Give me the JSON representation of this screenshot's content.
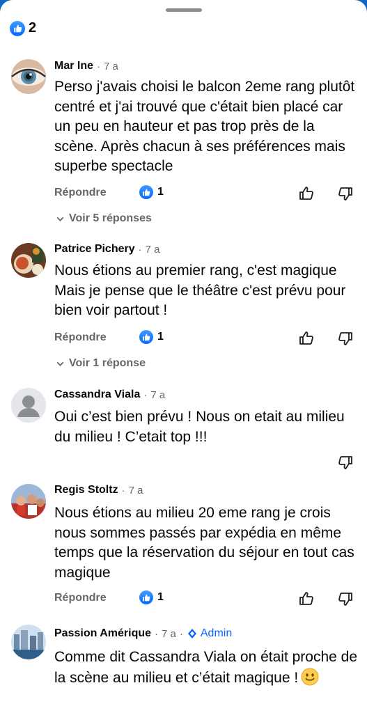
{
  "summary": {
    "like_count": "2"
  },
  "colors": {
    "brand_blue": "#0866ff",
    "muted_text": "#65676b",
    "background_frame": "#1565c0"
  },
  "comments": [
    {
      "author": "Mar Ine",
      "dot": "·",
      "time": "7 a",
      "text": "Perso j'avais choisi le balcon 2eme rang plutôt centré et j'ai trouvé que c'était bien placé car un peu en hauteur et pas trop près de la scène. Après chacun à ses préférences mais superbe spectacle",
      "reply_label": "Répondre",
      "likes": "1",
      "replies_label": "Voir 5 réponses",
      "avatar_icon": "eye-photo-avatar"
    },
    {
      "author": "Patrice Pichery",
      "dot": "·",
      "time": "7 a",
      "text": "Nous étions au premier rang, c'est magique Mais je pense que le théâtre c'est prévu pour bien voir partout !",
      "reply_label": "Répondre",
      "likes": "1",
      "replies_label": "Voir 1 réponse",
      "avatar_icon": "food-photo-avatar"
    },
    {
      "author": "Cassandra Viala",
      "dot": "·",
      "time": "7 a",
      "text": "Oui c’est bien prévu ! Nous on etait au milieu du milieu ! C’etait top !!!",
      "avatar_icon": "default-person-avatar"
    },
    {
      "author": "Regis Stoltz",
      "dot": "·",
      "time": "7 a",
      "text": "Nous étions au milieu 20 eme rang je crois nous sommes passés par expédia en même temps que la réservation du séjour en tout cas magique",
      "reply_label": "Répondre",
      "likes": "1",
      "avatar_icon": "group-photo-avatar"
    },
    {
      "author": "Passion Amérique",
      "dot": "·",
      "time": "7 a",
      "dot2": "·",
      "badge": "Admin",
      "text": "Comme dit Cassandra Viala on était proche de la scène au milieu et c’était magique !",
      "emoji": "slightly-smiling-face",
      "avatar_icon": "city-photo-avatar"
    }
  ]
}
